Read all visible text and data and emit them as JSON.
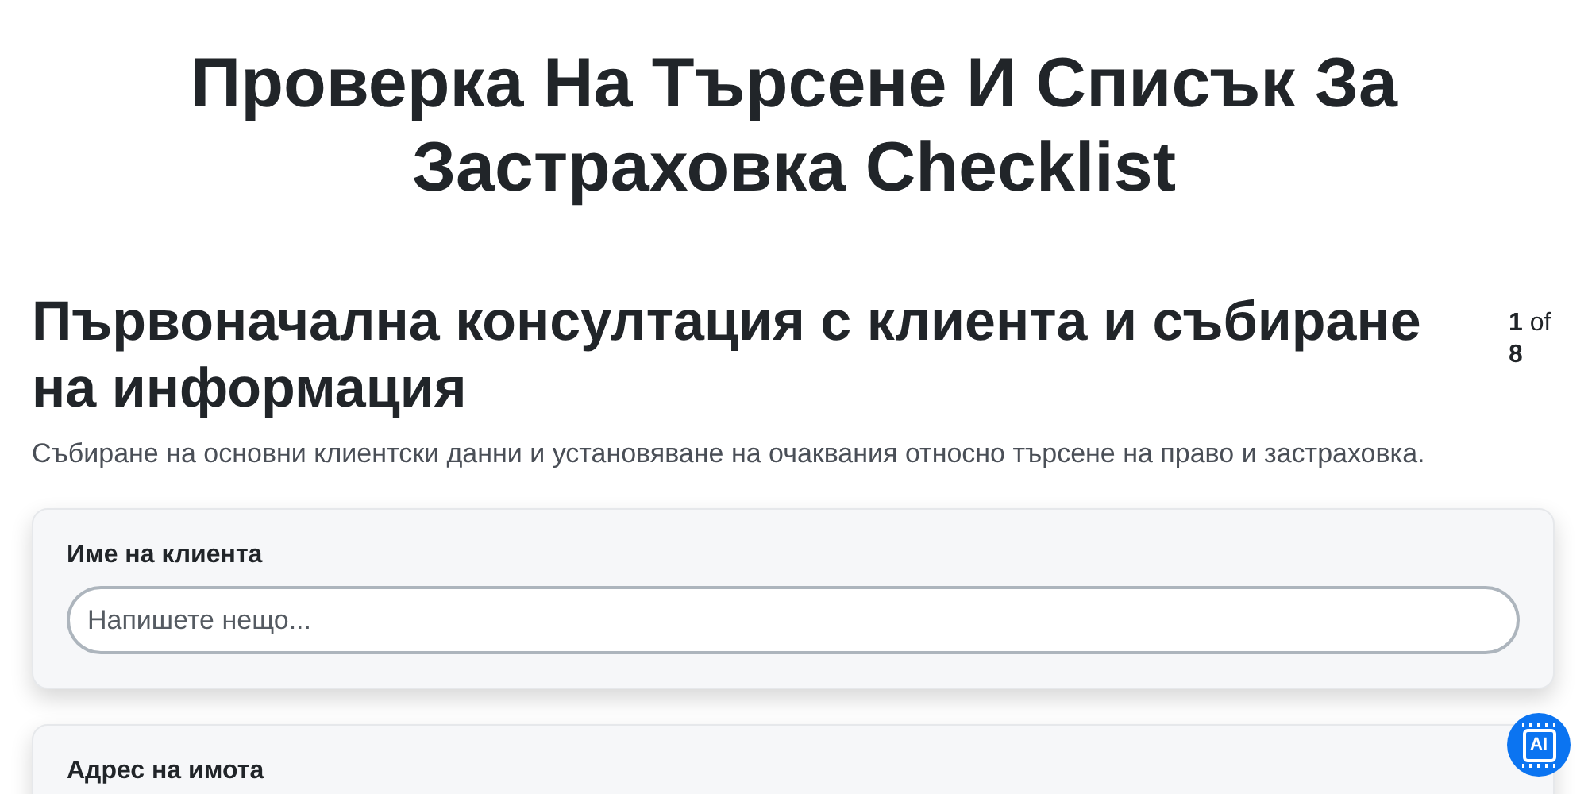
{
  "title": "Проверка На Търсене И Списък За Застраховка Checklist",
  "section": {
    "title": "Първоначална консултация с клиента и събиране на информация",
    "counter": "**1** of **8**",
    "description": "Събиране на основни клиентски данни и установяване на очаквания относно търсене на право и застраховка."
  },
  "fields": [
    {
      "label": "Име на клиента",
      "placeholder": "Напишете нещо..."
    },
    {
      "label": "Адрес на имота"
    }
  ],
  "assistant_button": {
    "label": "AI"
  }
}
